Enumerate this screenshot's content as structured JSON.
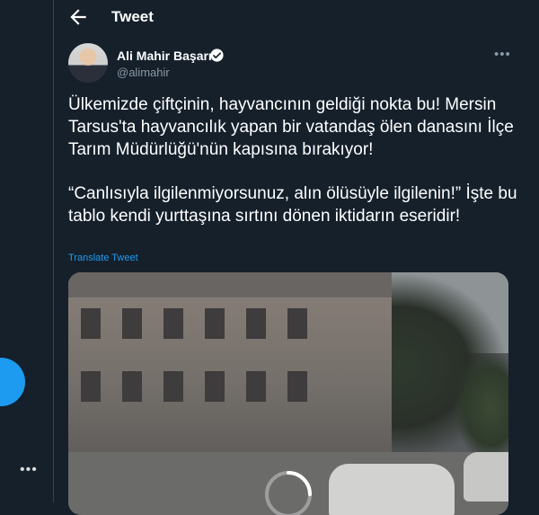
{
  "header": {
    "title": "Tweet"
  },
  "tweet": {
    "author": {
      "display_name": "Ali Mahir Başarır",
      "handle": "@alimahir",
      "verified": true
    },
    "paragraphs": [
      "Ülkemizde çiftçinin, hayvancının geldiği nokta bu! Mersin Tarsus'ta hayvancılık yapan bir vatandaş ölen danasını İlçe Tarım Müdürlüğü'nün kapısına bırakıyor!",
      "“Canlısıyla ilgilenmiyorsunuz, alın ölüsüyle ilgilenin!” İşte bu tablo kendi yurttaşına sırtını dönen iktidarın eseridir!"
    ],
    "translate_label": "Translate Tweet",
    "media": {
      "type": "video",
      "state": "loading"
    }
  },
  "sidebar": {
    "more_label": "•••"
  },
  "icons": {
    "back": "back-arrow-icon",
    "verified": "verified-badge-icon",
    "more": "more-horizontal-icon",
    "spinner": "loading-spinner-icon"
  },
  "colors": {
    "background": "#15202b",
    "accent": "#1d9bf0",
    "secondary_text": "#8899a6",
    "border": "#38444d"
  }
}
